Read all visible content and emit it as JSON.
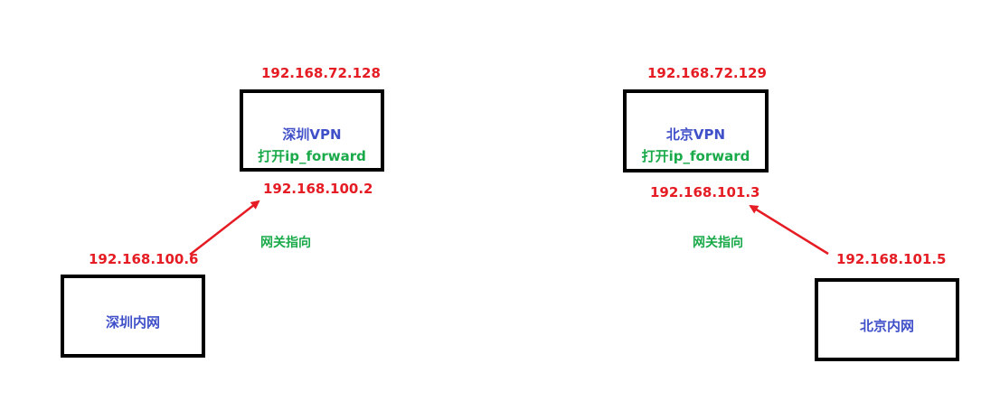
{
  "colors": {
    "ip_label": "#e51c23",
    "node_name": "#4050c8",
    "forward_note": "#1aaa4a",
    "arrow": "#e51c23",
    "box_border": "#000000"
  },
  "shenzhen": {
    "vpn": {
      "outer_ip": "192.168.72.128",
      "name": "深圳VPN",
      "note": "打开ip_forward",
      "inner_ip": "192.168.100.2"
    },
    "lan": {
      "name": "深圳内网",
      "ip": "192.168.100.6"
    },
    "gateway_note": "网关指向"
  },
  "beijing": {
    "vpn": {
      "outer_ip": "192.168.72.129",
      "name": "北京VPN",
      "note": "打开ip_forward",
      "inner_ip": "192.168.101.3"
    },
    "lan": {
      "name": "北京内网",
      "ip": "192.168.101.5"
    },
    "gateway_note": "网关指向"
  }
}
